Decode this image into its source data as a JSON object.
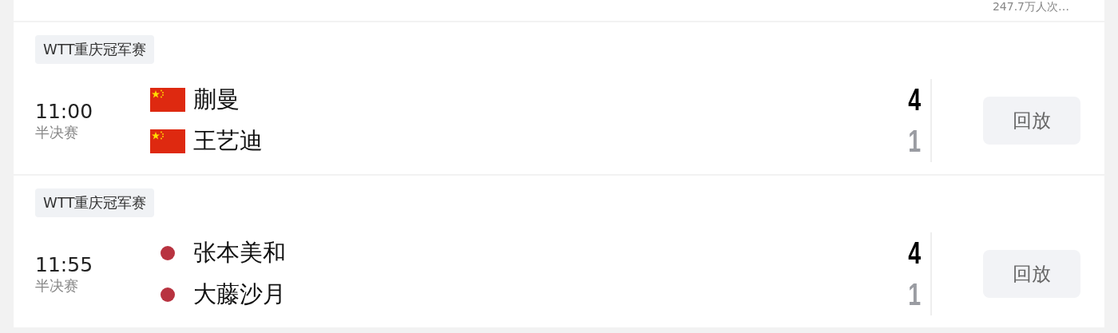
{
  "top_note": "247.7万人次…",
  "matches": [
    {
      "event": "WTT重庆冠军赛",
      "time": "11:00",
      "round": "半决赛",
      "action": "回放",
      "players": [
        {
          "name": "蒯曼",
          "kind": "flag",
          "score": "4",
          "winner": true
        },
        {
          "name": "王艺迪",
          "kind": "flag",
          "score": "1",
          "winner": false
        }
      ]
    },
    {
      "event": "WTT重庆冠军赛",
      "time": "11:55",
      "round": "半决赛",
      "action": "回放",
      "players": [
        {
          "name": "张本美和",
          "kind": "dot",
          "color": "#b83340",
          "score": "4",
          "winner": true
        },
        {
          "name": "大藤沙月",
          "kind": "dot",
          "color": "#b83340",
          "score": "1",
          "winner": false
        }
      ]
    }
  ]
}
